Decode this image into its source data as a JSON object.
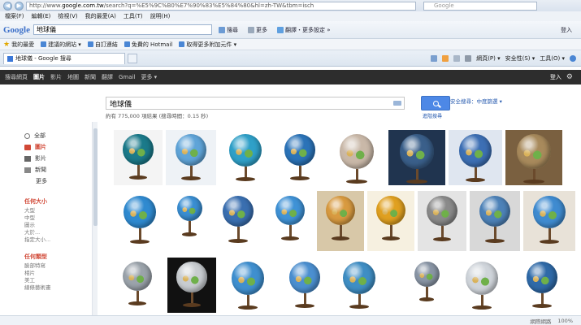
{
  "browser": {
    "url_prefix": "http://www.",
    "url_domain": "google.com.tw",
    "url_rest": "/search?q=%E5%9C%B0%E7%90%83%E5%84%80&hl=zh-TW&tbm=isch",
    "right_search_placeholder": "Google",
    "menu": [
      "檔案(F)",
      "編輯(E)",
      "檢視(V)",
      "我的最愛(A)",
      "工具(T)",
      "說明(H)"
    ],
    "google_toolbar": {
      "logo": "Google",
      "query": "地球儀",
      "search_btn": "搜尋",
      "more_btn": "更多",
      "translate": "翻譯・更多設定 »",
      "signin": "登入"
    },
    "favorites": {
      "label": "我的最愛",
      "items": [
        "建議的網站 ▾",
        "自訂連結",
        "免費的 Hotmail",
        "取得更多附加元件 ▾"
      ]
    },
    "tab": {
      "title": "地球儀 - Google 搜尋"
    },
    "commands": [
      "網頁(P) ▾",
      "安全性(S) ▾",
      "工具(O) ▾"
    ]
  },
  "google_bar": {
    "items": [
      "搜尋網頁",
      "圖片",
      "影片",
      "地圖",
      "新聞",
      "翻譯",
      "Gmail",
      "更多 ▾"
    ],
    "active_index": 1,
    "signin": "登入"
  },
  "search": {
    "query": "地球儀",
    "stats": "約有 775,000 項結果 (搜尋時間：0.15 秒)",
    "safe_search": "安全搜尋：中度篩選 ▾",
    "advanced": "進階搜尋"
  },
  "left_nav": {
    "items": [
      {
        "label": "全部",
        "icon": "search-icon",
        "active": false
      },
      {
        "label": "圖片",
        "icon": "camera-icon",
        "active": true
      },
      {
        "label": "影片",
        "icon": "film-icon",
        "active": false
      },
      {
        "label": "新聞",
        "icon": "newspaper-icon",
        "active": false
      }
    ],
    "more": "更多",
    "size_section": {
      "title": "任何大小",
      "options": [
        "大型",
        "中型",
        "圖示",
        "大於...",
        "指定大小..."
      ]
    },
    "type_section": {
      "title": "任何類型",
      "options": [
        "臉部特寫",
        "相片",
        "美工",
        "線條藝術畫"
      ]
    }
  },
  "colors": {
    "google_bar_bg": "#2d2d2d",
    "accent_red": "#d14836",
    "search_blue": "#4d88e6",
    "link_blue": "#2a5db0"
  },
  "status_bar": [
    "網際網路",
    "100%"
  ]
}
